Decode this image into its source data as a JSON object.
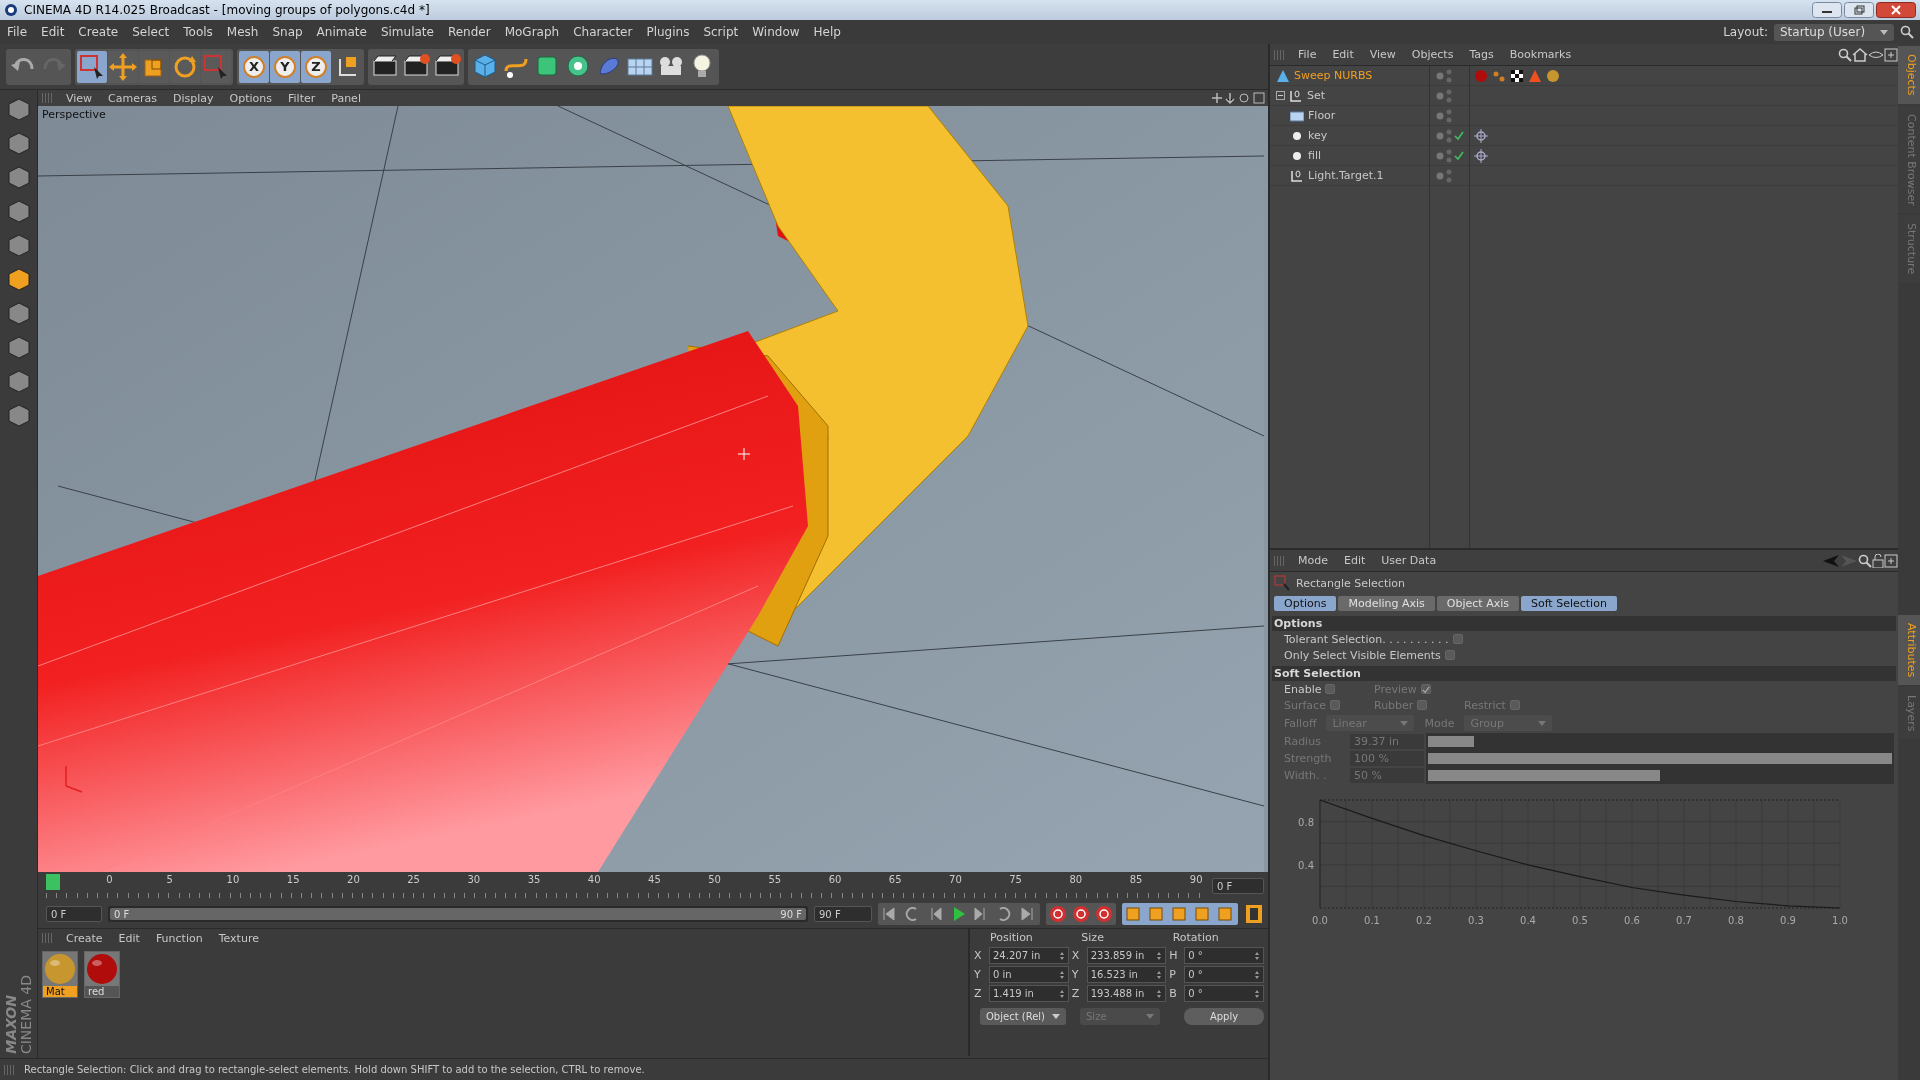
{
  "window": {
    "title": "CINEMA 4D R14.025 Broadcast - [moving groups of polygons.c4d *]"
  },
  "menu": [
    "File",
    "Edit",
    "Create",
    "Select",
    "Tools",
    "Mesh",
    "Snap",
    "Animate",
    "Simulate",
    "Render",
    "MoGraph",
    "Character",
    "Plugins",
    "Script",
    "Window",
    "Help"
  ],
  "layout": {
    "label": "Layout:",
    "value": "Startup (User)"
  },
  "toolbar": {
    "tools": [
      {
        "selected": true
      },
      {
        "selected": false
      },
      {
        "selected": false
      },
      {
        "selected": false
      },
      {
        "selected": false
      }
    ],
    "axes": [
      {
        "label": "X",
        "on": true
      },
      {
        "label": "Y",
        "on": true
      },
      {
        "label": "Z",
        "on": true
      }
    ]
  },
  "viewport": {
    "menu": [
      "View",
      "Cameras",
      "Display",
      "Options",
      "Filter",
      "Panel"
    ],
    "label": "Perspective"
  },
  "timeline": {
    "range": {
      "level": 1
    },
    "ticks": [
      "0",
      "5",
      "10",
      "15",
      "20",
      "25",
      "30",
      "35",
      "40",
      "45",
      "50",
      "55",
      "60",
      "65",
      "70",
      "75",
      "80",
      "85",
      "90"
    ],
    "playhead": {
      "level": 0
    },
    "current": "0 F",
    "start": "0 F",
    "range_start": "0 F",
    "range_end": "90 F",
    "end": "90 F"
  },
  "materials": {
    "menu": [
      "Create",
      "Edit",
      "Function",
      "Texture"
    ],
    "items": [
      {
        "name": "Mat",
        "color": "#c8962e",
        "selected": true
      },
      {
        "name": "red",
        "color": "#b00c0c",
        "selected": false
      }
    ]
  },
  "coordinates": {
    "headers": [
      "Position",
      "Size",
      "Rotation"
    ],
    "rows": [
      {
        "pos_axis": "X",
        "position": "24.207 in",
        "size_axis": "X",
        "size": "233.859 in",
        "rot_axis": "H",
        "rotation": "0 °"
      },
      {
        "pos_axis": "Y",
        "position": "0 in",
        "size_axis": "Y",
        "size": "16.523 in",
        "rot_axis": "P",
        "rotation": "0 °"
      },
      {
        "pos_axis": "Z",
        "position": "1.419 in",
        "size_axis": "Z",
        "size": "193.488 in",
        "rot_axis": "B",
        "rotation": "0 °"
      }
    ],
    "mode": "Object (Rel)",
    "size_mode": {
      "value": "Size",
      "disabled": true
    },
    "apply": "Apply"
  },
  "logo": [
    "MAXON",
    "CINEMA 4D"
  ],
  "status_bar": "Rectangle Selection: Click and drag to rectangle-select elements. Hold down SHIFT to add to the selection, CTRL to remove.",
  "objects": {
    "menu": [
      "File",
      "Edit",
      "View",
      "Objects",
      "Tags",
      "Bookmarks"
    ],
    "tree": [
      {
        "name": "Sweep NURBS",
        "kind": "nurbs",
        "selected": true,
        "checked": false,
        "tags": [
          {
            "kind": "material",
            "color": "#b00c0c"
          },
          {
            "kind": "points"
          },
          {
            "kind": "texture"
          },
          {
            "kind": "cone"
          },
          {
            "kind": "material",
            "color": "#c8962e"
          }
        ]
      },
      {
        "name": "Set",
        "kind": "null",
        "selected": false,
        "checked": false,
        "expanded": true,
        "children": [
          {
            "name": "Floor",
            "kind": "floor",
            "selected": false,
            "checked": false
          },
          {
            "name": "key",
            "kind": "light",
            "selected": false,
            "checked": true,
            "tags": [
              {
                "kind": "target"
              }
            ]
          },
          {
            "name": "fill",
            "kind": "light",
            "selected": false,
            "checked": true,
            "tags": [
              {
                "kind": "target"
              }
            ]
          },
          {
            "name": "Light.Target.1",
            "kind": "null",
            "selected": false,
            "checked": false
          }
        ]
      }
    ]
  },
  "side_tabs": {
    "top": [
      {
        "label": "Objects",
        "selected": true
      },
      {
        "label": "Content Browser",
        "selected": false
      },
      {
        "label": "Structure",
        "selected": false
      }
    ],
    "bottom": [
      {
        "label": "Attributes",
        "selected": true
      },
      {
        "label": "Layers",
        "selected": false
      }
    ]
  },
  "attributes": {
    "menu": [
      "Mode",
      "Edit",
      "User Data"
    ],
    "title": "Rectangle Selection",
    "tabs": [
      {
        "label": "Options",
        "selected": true
      },
      {
        "label": "Modeling Axis",
        "selected": false
      },
      {
        "label": "Object Axis",
        "selected": false
      },
      {
        "label": "Soft Selection",
        "selected": true
      }
    ],
    "options_title": "Options",
    "options": [
      {
        "label": "Tolerant Selection. . . . . . . . . .",
        "checked": false
      },
      {
        "label": "Only Select Visible Elements",
        "checked": false
      }
    ],
    "soft_title": "Soft Selection",
    "check_rows": [
      [
        {
          "label": "Enable",
          "checked": false,
          "disabled": false
        },
        {
          "label": "Preview",
          "checked": true,
          "disabled": true
        }
      ],
      [
        {
          "label": "Surface",
          "checked": false,
          "disabled": true
        },
        {
          "label": "Rubber",
          "checked": false,
          "disabled": true
        },
        {
          "label": "Restrict",
          "checked": false,
          "disabled": true
        }
      ]
    ],
    "dropdowns": [
      {
        "label": "Falloff",
        "value": "Linear",
        "disabled": true
      },
      {
        "label": "Mode",
        "value": "Group",
        "disabled": true
      }
    ],
    "sliders": [
      {
        "label": "Radius",
        "value": "39.37 in",
        "level": 0.1,
        "disabled": true
      },
      {
        "label": "Strength",
        "value": "100 %",
        "level": 1,
        "disabled": true
      },
      {
        "label": "Width. .",
        "value": "50 %",
        "level": 0.5,
        "disabled": true
      }
    ],
    "chart_data": {
      "type": "line",
      "x": [
        0,
        0.1,
        0.2,
        0.3,
        0.4,
        0.5,
        0.6,
        0.7,
        0.8,
        0.9,
        1.0
      ],
      "series": [
        {
          "color": "#1a1a1a",
          "values": [
            1,
            0.83,
            0.67,
            0.53,
            0.4,
            0.29,
            0.19,
            0.12,
            0.06,
            0.02,
            0
          ]
        }
      ],
      "xlim": [
        0,
        1
      ],
      "ylim": [
        0,
        1
      ],
      "grid": true,
      "ref_lines": [
        {
          "axis": "y",
          "value": 1
        },
        {
          "axis": "y",
          "value": 0
        }
      ],
      "xticks": [
        {
          "value": 0,
          "label": "0.0"
        },
        {
          "value": 0.1,
          "label": "0.1"
        },
        {
          "value": 0.2,
          "label": "0.2"
        },
        {
          "value": 0.3,
          "label": "0.3"
        },
        {
          "value": 0.4,
          "label": "0.4"
        },
        {
          "value": 0.5,
          "label": "0.5"
        },
        {
          "value": 0.6,
          "label": "0.6"
        },
        {
          "value": 0.7,
          "label": "0.7"
        },
        {
          "value": 0.8,
          "label": "0.8"
        },
        {
          "value": 0.9,
          "label": "0.9"
        },
        {
          "value": 1,
          "label": "1.0"
        }
      ],
      "yticks": [
        0.4,
        0.8
      ]
    }
  }
}
